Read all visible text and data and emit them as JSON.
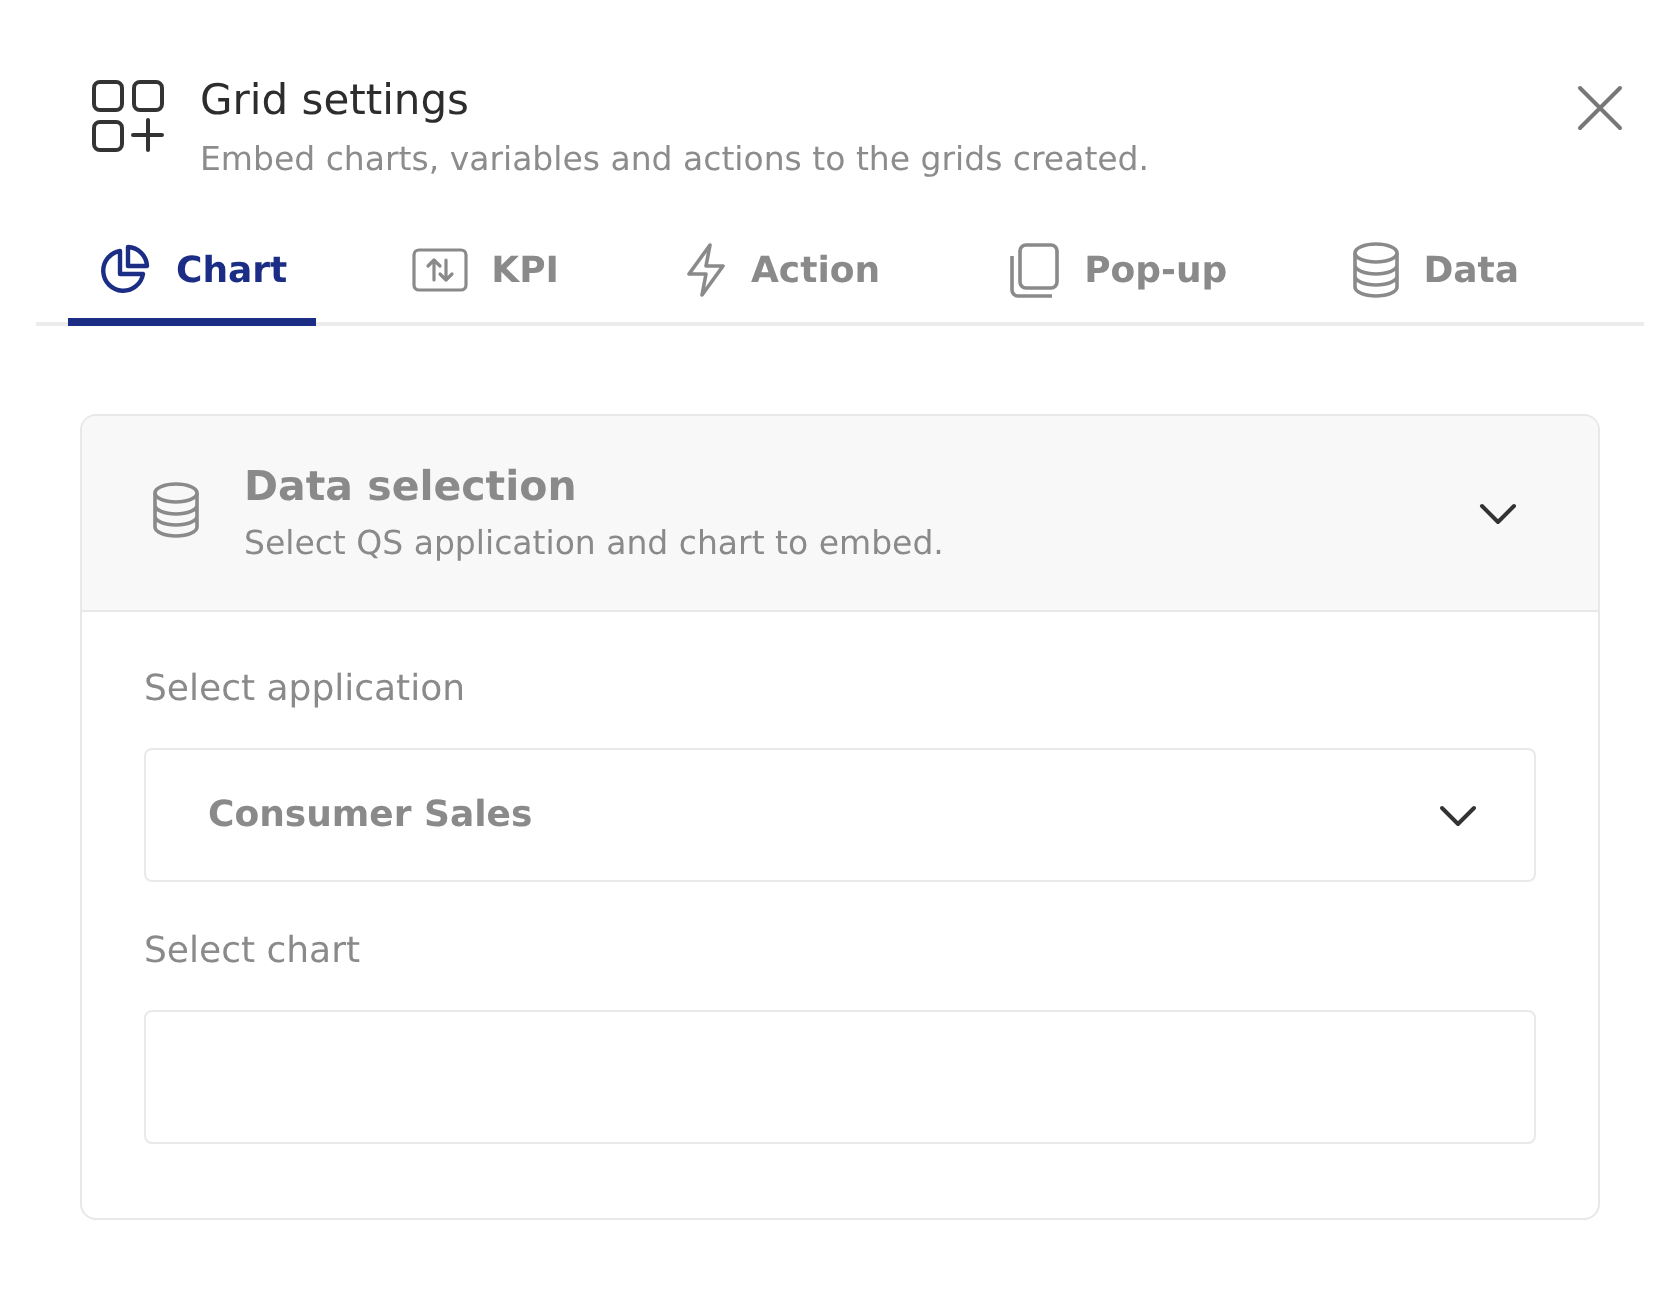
{
  "header": {
    "title": "Grid settings",
    "subtitle": "Embed charts, variables and actions to the grids created."
  },
  "tabs": [
    {
      "label": "Chart",
      "kind": "pie",
      "selected": true
    },
    {
      "label": "KPI",
      "kind": "arrows",
      "selected": false
    },
    {
      "label": "Action",
      "kind": "bolt",
      "selected": false
    },
    {
      "label": "Pop-up",
      "kind": "pages",
      "selected": false
    },
    {
      "label": "Data",
      "kind": "database",
      "selected": false
    }
  ],
  "panel": {
    "title": "Data selection",
    "subtitle": "Select QS application and chart to embed.",
    "expanded": true,
    "fields": [
      {
        "label": "Select application",
        "kind": "select",
        "value": "Consumer Sales"
      },
      {
        "label": "Select chart",
        "kind": "input"
      }
    ]
  }
}
